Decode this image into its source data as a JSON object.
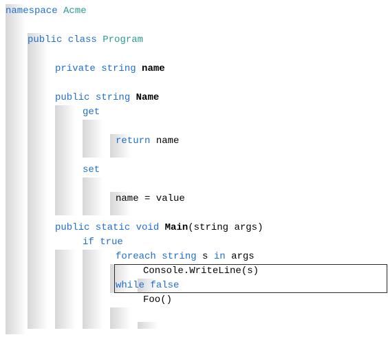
{
  "code": {
    "ns_kw": "namespace",
    "ns_name": "Acme",
    "class_mods": "public class",
    "class_name": "Program",
    "field_mods": "private",
    "field_type": "string",
    "field_name": "name",
    "prop_mods": "public",
    "prop_type": "string",
    "prop_name": "Name",
    "get_kw": "get",
    "get_return": "return",
    "get_expr": "name",
    "set_kw": "set",
    "set_expr": "name = value",
    "main_mods": "public static",
    "main_ret": "void",
    "main_name": "Main",
    "main_params": "(string args)",
    "if_kw": "if",
    "if_cond": "true",
    "foreach_kw": "foreach",
    "foreach_type": "string",
    "foreach_var": "s",
    "foreach_in": "in",
    "foreach_coll": "args",
    "foreach_body": "Console.WriteLine(s)",
    "while_kw": "while",
    "while_cond": "false",
    "while_body": "Foo()"
  }
}
